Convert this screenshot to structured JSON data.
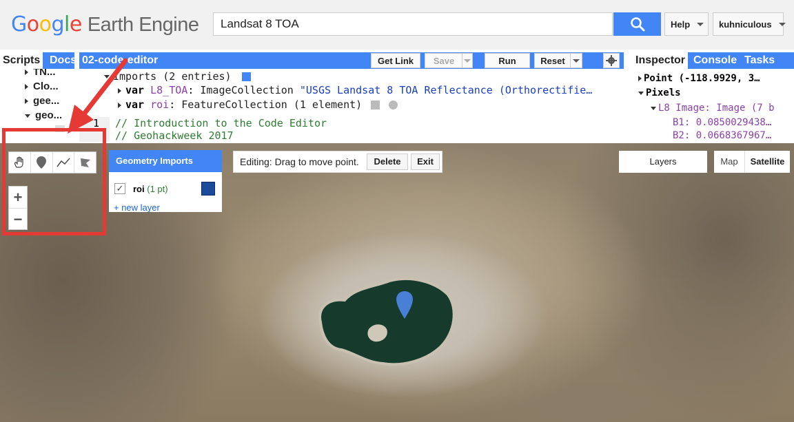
{
  "header": {
    "logo_google": [
      "G",
      "o",
      "o",
      "g",
      "l",
      "e"
    ],
    "logo_rest": "Earth Engine",
    "search_value": "Landsat 8 TOA",
    "help_label": "Help",
    "user_label": "kuhniculous"
  },
  "left_panel": {
    "tabs": [
      "Scripts",
      "Docs"
    ],
    "items": [
      {
        "label": "TN...",
        "expanded": false
      },
      {
        "label": "Clo...",
        "expanded": false
      },
      {
        "label": "gee...",
        "expanded": false
      },
      {
        "label": "geo...",
        "expanded": true
      }
    ]
  },
  "editor": {
    "title": "02-code-editor",
    "get_link": "Get Link",
    "save": "Save",
    "run": "Run",
    "reset": "Reset",
    "imports_header": "Imports (2 entries)",
    "imports": [
      {
        "kw": "var",
        "name": "L8_TOA",
        "type": "ImageCollection",
        "detail": "\"USGS Landsat 8 TOA Reflectance (Orthorectifie…"
      },
      {
        "kw": "var",
        "name": "roi",
        "type": "FeatureCollection",
        "detail": "(1 element)"
      }
    ],
    "line_number": "1",
    "comment1": "// Introduction to the Code Editor",
    "comment2": "// Geohackweek 2017"
  },
  "inspector": {
    "tabs": [
      "Inspector",
      "Console",
      "Tasks"
    ],
    "point_label": "Point (-118.9929, 3…",
    "pixels_label": "Pixels",
    "image_label": "L8 Image: Image (7 b",
    "b1": "B1: 0.0850029438…",
    "b2": "B2: 0.0668367967…"
  },
  "map": {
    "geometry_imports_title": "Geometry Imports",
    "layer_name": "roi",
    "layer_count": "(1 pt)",
    "layer_color": "#1a4a99",
    "new_layer": "+ new layer",
    "editing_text": "Editing: Drag to move point.",
    "delete_label": "Delete",
    "exit_label": "Exit",
    "layers_label": "Layers",
    "map_label": "Map",
    "satellite_label": "Satellite",
    "zoom_in": "+",
    "zoom_out": "−",
    "tools": [
      "hand-icon",
      "marker-icon",
      "line-icon",
      "polygon-icon"
    ]
  },
  "colors": {
    "accent": "#4285f4",
    "annotation": "#e53935"
  }
}
